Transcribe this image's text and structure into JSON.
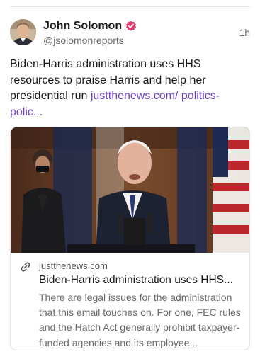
{
  "post": {
    "author_name": "John Solomon",
    "handle": "@jsolomonreports",
    "time": "1h",
    "text_main": "Biden-Harris administration uses HHS resources to praise Harris and help her presidential run ",
    "text_link": "justthenews.com/ politics-polic..."
  },
  "link_card": {
    "domain": "justthenews.com",
    "title": "Biden-Harris administration uses HHS...",
    "description": "There are legal issues for the administration that this email touches on. For one, FEC rules and the Hatch Act generally prohibit taxpayer-funded agencies and its employee..."
  },
  "icons": {
    "verified": "verified-badge-icon",
    "link": "link-icon"
  },
  "colors": {
    "link": "#6f42c1",
    "verified_badge": "#e23a6a"
  }
}
